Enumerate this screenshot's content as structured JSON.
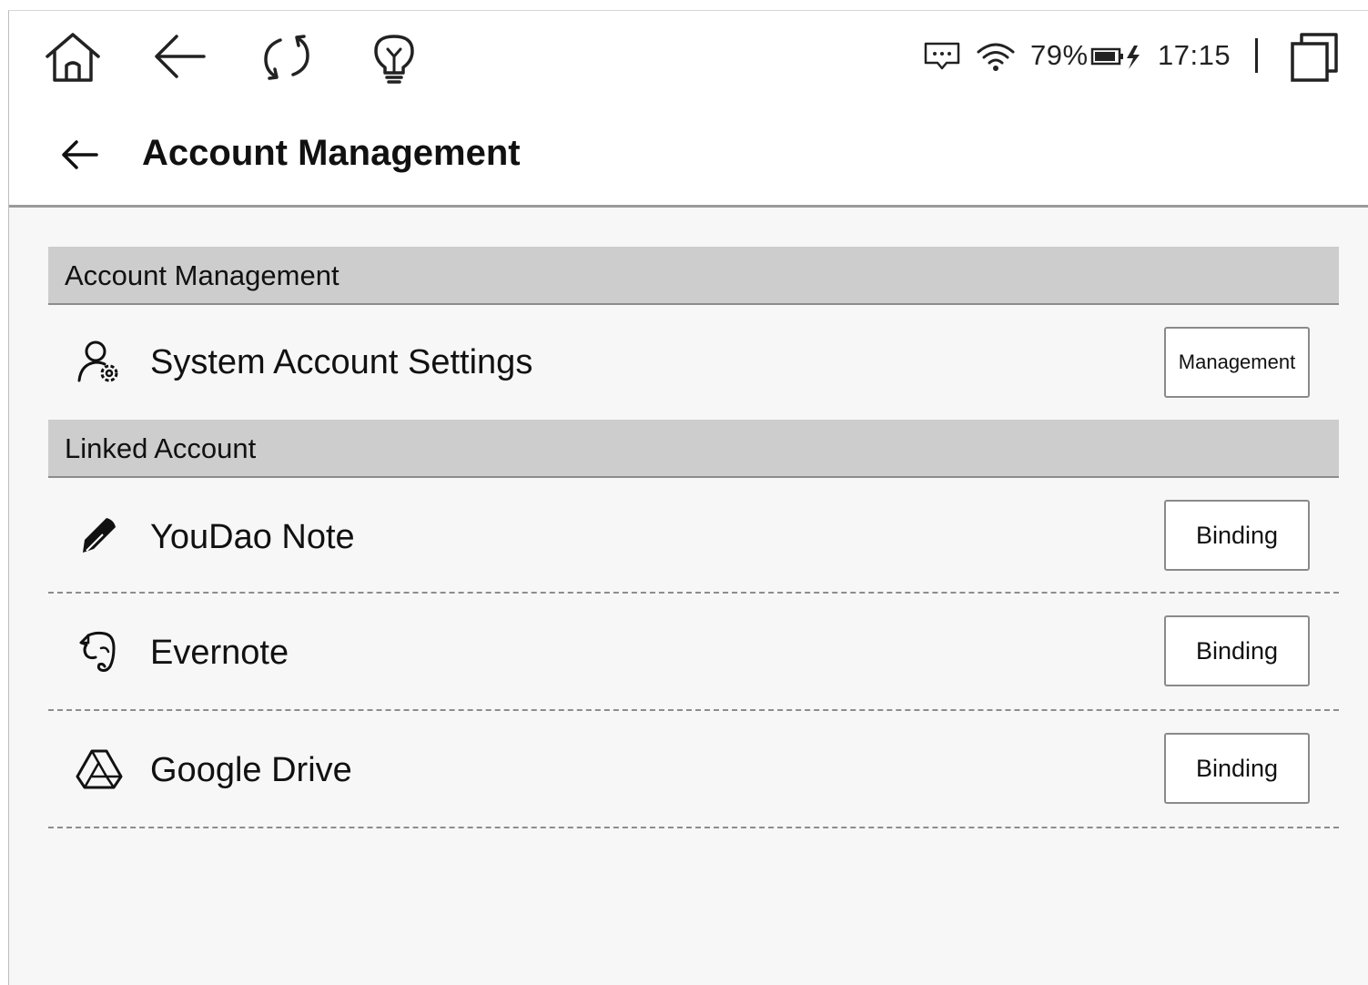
{
  "status_bar": {
    "left_icons": [
      "home-icon",
      "back-arrow-icon",
      "refresh-icon",
      "lightbulb-icon"
    ],
    "right_icons": [
      "message-icon",
      "wifi-icon",
      "battery-charging-icon",
      "window-switch-icon"
    ],
    "battery_percent": "79%",
    "time": "17:15"
  },
  "title_bar": {
    "back_icon": "back-arrow-icon",
    "title": "Account Management"
  },
  "sections": {
    "account": {
      "header": "Account Management",
      "items": [
        {
          "icon": "user-settings-icon",
          "label": "System Account Settings",
          "button": "Management"
        }
      ]
    },
    "linked": {
      "header": "Linked Account",
      "items": [
        {
          "icon": "youdao-pen-icon",
          "label": "YouDao Note",
          "button": "Binding"
        },
        {
          "icon": "evernote-elephant-icon",
          "label": "Evernote",
          "button": "Binding"
        },
        {
          "icon": "google-drive-icon",
          "label": "Google Drive",
          "button": "Binding"
        }
      ]
    }
  }
}
